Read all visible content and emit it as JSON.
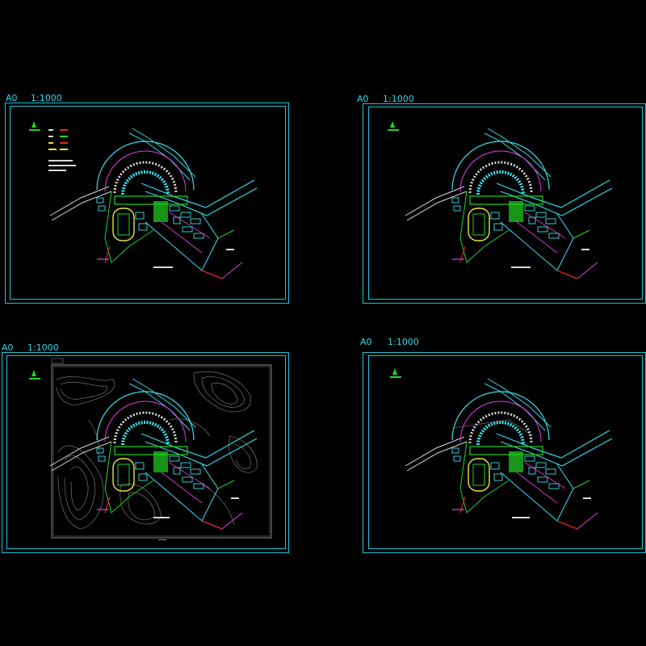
{
  "sheets": [
    {
      "size": "A0",
      "scale": "1:1000"
    },
    {
      "size": "A0",
      "scale": "1:1000"
    },
    {
      "size": "A0",
      "scale": "1:1000"
    },
    {
      "size": "A0",
      "scale": "1:1000"
    }
  ],
  "colors": {
    "background": "#000000",
    "frame": "#19c6d6",
    "road": "#2fd8e6",
    "building": "#3ae0ee",
    "magenta": "#e040e0",
    "green": "#22d322",
    "yellow": "#e8e83a",
    "red": "#e02626",
    "white": "#d8d8d8",
    "contour": "#8a8a8a"
  }
}
